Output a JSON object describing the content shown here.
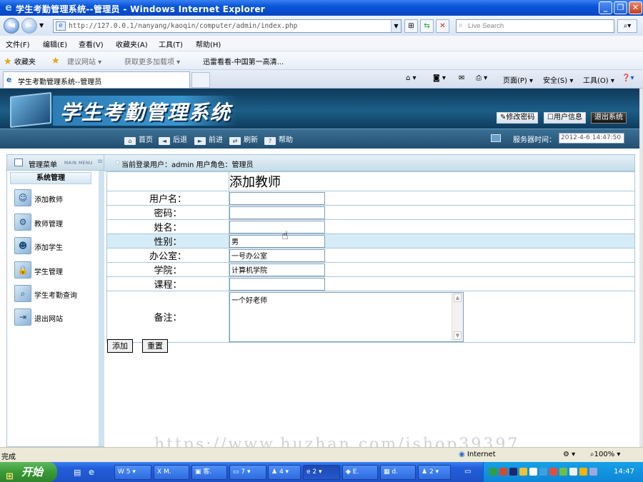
{
  "window": {
    "title": "学生考勤管理系统--管理员 - Windows Internet Explorer",
    "tab_title": "学生考勤管理系统--管理员"
  },
  "address": {
    "url": "http://127.0.0.1/nanyang/kaoqin/computer/admin/index.php",
    "search_placeholder": "Live Search"
  },
  "menu": [
    "文件(F)",
    "编辑(E)",
    "查看(V)",
    "收藏夹(A)",
    "工具(T)",
    "帮助(H)"
  ],
  "favorites": {
    "label": "收藏夹",
    "items": [
      "建议网站 ▾",
      "获取更多加载项 ▾",
      "迅雷看看-中国第一高清..."
    ]
  },
  "ie_tools": [
    "页面(P) ▾",
    "安全(S) ▾",
    "工具(O) ▾"
  ],
  "site": {
    "title": "学生考勤管理系统",
    "header_buttons": [
      "修改密码",
      "用户信息",
      "退出系统"
    ],
    "nav": [
      "首页",
      "后退",
      "前进",
      "刷新",
      "帮助"
    ],
    "server_time_label": "服务器时间：",
    "server_time": "2012-4-6 14:47:50"
  },
  "sidebar": {
    "title": "管理菜单",
    "subtitle": "MAIN MENU",
    "group": "系统管理",
    "items": [
      {
        "label": "添加教师",
        "icon": "person-add-icon"
      },
      {
        "label": "教师管理",
        "icon": "gear-icon"
      },
      {
        "label": "添加学生",
        "icon": "student-icon"
      },
      {
        "label": "学生管理",
        "icon": "lock-icon"
      },
      {
        "label": "学生考勤查询",
        "icon": "search-user-icon"
      },
      {
        "label": "退出网站",
        "icon": "exit-icon"
      }
    ]
  },
  "crumb": "当前登录用户：admin  用户角色：管理员",
  "form": {
    "heading": "添加教师",
    "fields": [
      {
        "label": "用户名：",
        "value": ""
      },
      {
        "label": "密码：",
        "value": ""
      },
      {
        "label": "姓名：",
        "value": ""
      },
      {
        "label": "性别：",
        "value": "男"
      },
      {
        "label": "办公室：",
        "value": "一号办公室"
      },
      {
        "label": "学院：",
        "value": "计算机学院"
      },
      {
        "label": "课程：",
        "value": ""
      }
    ],
    "remark_label": "备注：",
    "remark_value": "一个好老师",
    "submit": "添加",
    "reset": "重置"
  },
  "watermark": "https://www.huzhan.com/ishop39397",
  "statusbar": {
    "status": "完成",
    "zone": "Internet",
    "zoom": "100%"
  },
  "taskbar": {
    "start": "开始",
    "buttons": [
      "5",
      "M.",
      "客.",
      "7",
      "4",
      "2",
      "E.",
      "d.",
      "2"
    ],
    "clock": "14:47"
  }
}
